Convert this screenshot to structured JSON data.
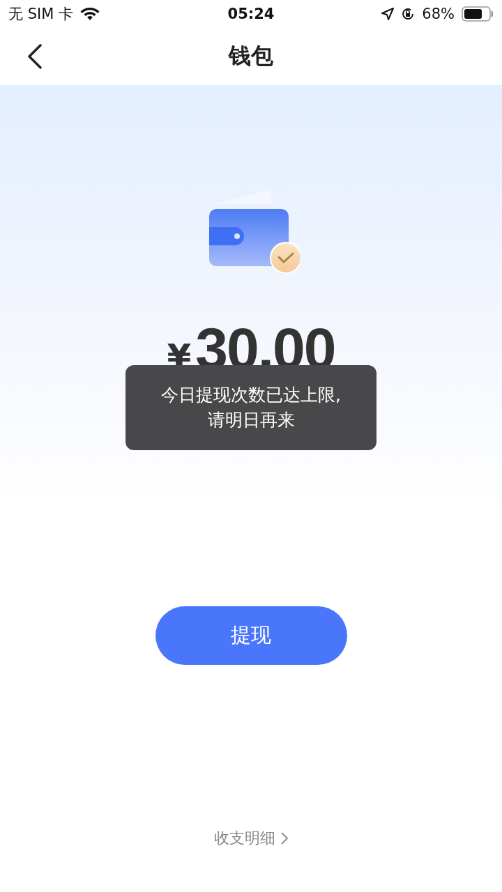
{
  "status_bar": {
    "carrier": "无 SIM 卡",
    "time": "05:24",
    "battery": "68%"
  },
  "nav": {
    "title": "钱包"
  },
  "balance": {
    "currency": "¥",
    "amount": "30.00"
  },
  "toast": {
    "lines": [
      "今日提现次数已达上限,",
      "请明日再来"
    ]
  },
  "withdraw_button": "提现",
  "details_link": "收支明细"
}
